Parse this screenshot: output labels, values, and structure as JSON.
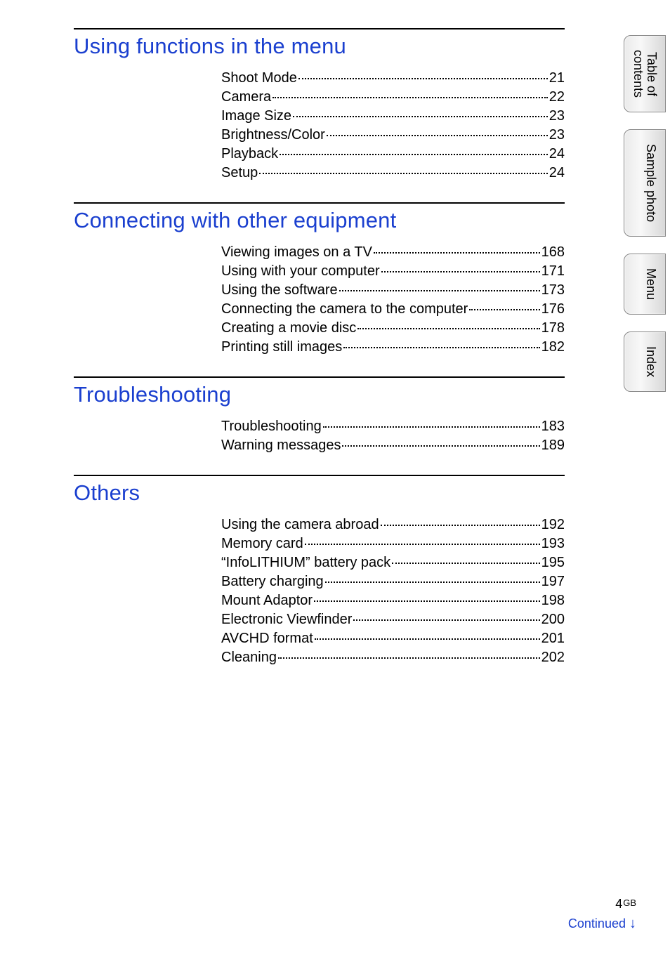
{
  "sections": [
    {
      "title": "Using functions in the menu",
      "items": [
        {
          "label": "Shoot Mode",
          "page": "21"
        },
        {
          "label": "Camera",
          "page": "22"
        },
        {
          "label": "Image Size",
          "page": "23"
        },
        {
          "label": "Brightness/Color",
          "page": "23"
        },
        {
          "label": "Playback",
          "page": "24"
        },
        {
          "label": "Setup",
          "page": "24"
        }
      ]
    },
    {
      "title": "Connecting with other equipment",
      "items": [
        {
          "label": "Viewing images on a TV",
          "page": "168"
        },
        {
          "label": "Using with your computer",
          "page": "171"
        },
        {
          "label": "Using the software",
          "page": "173"
        },
        {
          "label": "Connecting the camera to the computer",
          "page": "176"
        },
        {
          "label": "Creating a movie disc",
          "page": "178"
        },
        {
          "label": "Printing still images",
          "page": "182"
        }
      ]
    },
    {
      "title": "Troubleshooting",
      "items": [
        {
          "label": "Troubleshooting",
          "page": "183"
        },
        {
          "label": "Warning messages",
          "page": "189"
        }
      ]
    },
    {
      "title": "Others",
      "items": [
        {
          "label": "Using the camera abroad",
          "page": "192"
        },
        {
          "label": "Memory card",
          "page": "193"
        },
        {
          "label": "“InfoLITHIUM” battery pack",
          "page": "195"
        },
        {
          "label": "Battery charging",
          "page": "197"
        },
        {
          "label": "Mount Adaptor",
          "page": "198"
        },
        {
          "label": "Electronic Viewfinder",
          "page": "200"
        },
        {
          "label": "AVCHD format",
          "page": "201"
        },
        {
          "label": "Cleaning",
          "page": "202"
        }
      ]
    }
  ],
  "tabs": {
    "toc_line1": "Table of",
    "toc_line2": "contents",
    "sample": "Sample photo",
    "menu": "Menu",
    "index": "Index"
  },
  "footer": {
    "pagenum": "4",
    "gb": "GB",
    "continued": "Continued",
    "arrow": "↓"
  }
}
